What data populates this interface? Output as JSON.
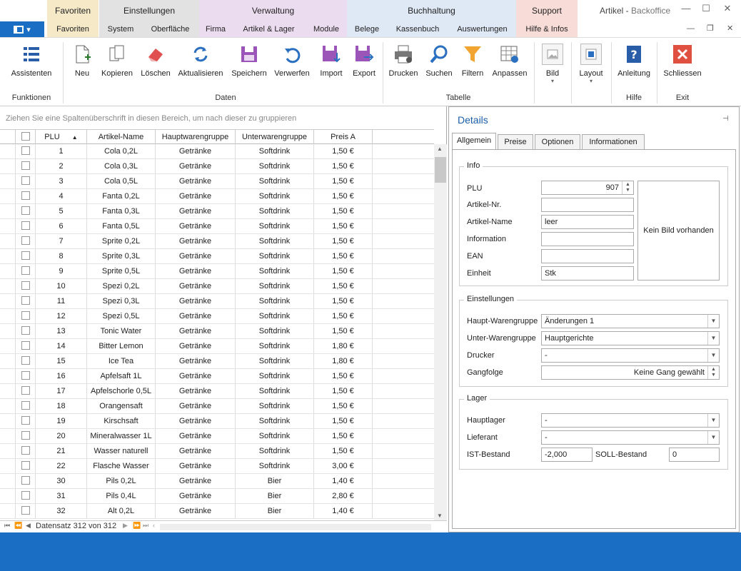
{
  "window": {
    "title_app": "Artikel",
    "title_sep": " - ",
    "title_module": "Backoffice",
    "minimize": "—",
    "maximize": "☐",
    "close": "✕"
  },
  "appmenu": {
    "icon": "panel-icon",
    "chevron": "▾"
  },
  "ribbon_groups": [
    {
      "name": "Favoriten",
      "color": "#f5e9c8",
      "tabs": [
        "Favoriten"
      ]
    },
    {
      "name": "Einstellungen",
      "color": "#e2e2e2",
      "tabs": [
        "System",
        "Oberfläche"
      ]
    },
    {
      "name": "Verwaltung",
      "color": "#ecdcef",
      "tabs": [
        "Firma",
        "Artikel & Lager",
        "Module"
      ]
    },
    {
      "name": "Buchhaltung",
      "color": "#dfe8f5",
      "tabs": [
        "Belege",
        "Kassenbuch",
        "Auswertungen"
      ]
    },
    {
      "name": "Support",
      "color": "#f8dcd8",
      "tabs": [
        "Hilfe & Infos"
      ]
    }
  ],
  "ribbon_buttons": {
    "assistenten": "Assistenten",
    "neu": "Neu",
    "kopieren": "Kopieren",
    "loeschen": "Löschen",
    "aktualisieren": "Aktualisieren",
    "speichern": "Speichern",
    "verwerfen": "Verwerfen",
    "import": "Import",
    "export": "Export",
    "drucken": "Drucken",
    "suchen": "Suchen",
    "filtern": "Filtern",
    "anpassen": "Anpassen",
    "bild": "Bild",
    "layout": "Layout",
    "anleitung": "Anleitung",
    "schliessen": "Schliessen"
  },
  "ribbon_group_labels": {
    "funktionen": "Funktionen",
    "daten": "Daten",
    "tabelle": "Tabelle",
    "hilfe": "Hilfe",
    "exit": "Exit"
  },
  "grid": {
    "group_hint": "Ziehen Sie eine Spaltenüberschrift in diesen Bereich, um nach dieser zu gruppieren",
    "columns": [
      "PLU",
      "Artikel-Name",
      "Hauptwarengruppe",
      "Unterwarengruppe",
      "Preis A"
    ],
    "rows": [
      [
        "1",
        "Cola 0,2L",
        "Getränke",
        "Softdrink",
        "1,50 €"
      ],
      [
        "2",
        "Cola 0,3L",
        "Getränke",
        "Softdrink",
        "1,50 €"
      ],
      [
        "3",
        "Cola 0,5L",
        "Getränke",
        "Softdrink",
        "1,50 €"
      ],
      [
        "4",
        "Fanta 0,2L",
        "Getränke",
        "Softdrink",
        "1,50 €"
      ],
      [
        "5",
        "Fanta 0,3L",
        "Getränke",
        "Softdrink",
        "1,50 €"
      ],
      [
        "6",
        "Fanta 0,5L",
        "Getränke",
        "Softdrink",
        "1,50 €"
      ],
      [
        "7",
        "Sprite 0,2L",
        "Getränke",
        "Softdrink",
        "1,50 €"
      ],
      [
        "8",
        "Sprite 0,3L",
        "Getränke",
        "Softdrink",
        "1,50 €"
      ],
      [
        "9",
        "Sprite 0,5L",
        "Getränke",
        "Softdrink",
        "1,50 €"
      ],
      [
        "10",
        "Spezi 0,2L",
        "Getränke",
        "Softdrink",
        "1,50 €"
      ],
      [
        "11",
        "Spezi 0,3L",
        "Getränke",
        "Softdrink",
        "1,50 €"
      ],
      [
        "12",
        "Spezi 0,5L",
        "Getränke",
        "Softdrink",
        "1,50 €"
      ],
      [
        "13",
        "Tonic Water",
        "Getränke",
        "Softdrink",
        "1,50 €"
      ],
      [
        "14",
        "Bitter Lemon",
        "Getränke",
        "Softdrink",
        "1,80 €"
      ],
      [
        "15",
        "Ice Tea",
        "Getränke",
        "Softdrink",
        "1,80 €"
      ],
      [
        "16",
        "Apfelsaft 1L",
        "Getränke",
        "Softdrink",
        "1,50 €"
      ],
      [
        "17",
        "Apfelschorle 0,5L",
        "Getränke",
        "Softdrink",
        "1,50 €"
      ],
      [
        "18",
        "Orangensaft",
        "Getränke",
        "Softdrink",
        "1,50 €"
      ],
      [
        "19",
        "Kirschsaft",
        "Getränke",
        "Softdrink",
        "1,50 €"
      ],
      [
        "20",
        "Mineralwasser 1L",
        "Getränke",
        "Softdrink",
        "1,50 €"
      ],
      [
        "21",
        "Wasser naturell",
        "Getränke",
        "Softdrink",
        "1,50 €"
      ],
      [
        "22",
        "Flasche Wasser",
        "Getränke",
        "Softdrink",
        "3,00 €"
      ],
      [
        "30",
        "Pils 0,2L",
        "Getränke",
        "Bier",
        "1,40 €"
      ],
      [
        "31",
        "Pils 0,4L",
        "Getränke",
        "Bier",
        "2,80 €"
      ],
      [
        "32",
        "Alt 0,2L",
        "Getränke",
        "Bier",
        "1,40 €"
      ]
    ],
    "record_text": "Datensatz 312 von 312"
  },
  "details": {
    "title": "Details",
    "pin": "⊣",
    "tabs": [
      "Allgemein",
      "Preise",
      "Optionen",
      "Informationen"
    ],
    "info": {
      "legend": "Info",
      "plu_label": "PLU",
      "plu_value": "907",
      "artnr_label": "Artikel-Nr.",
      "artnr_value": "",
      "name_label": "Artikel-Name",
      "name_value": "leer",
      "information_label": "Information",
      "information_value": "",
      "ean_label": "EAN",
      "ean_value": "",
      "einheit_label": "Einheit",
      "einheit_value": "Stk",
      "image_text": "Kein Bild vorhanden"
    },
    "settings": {
      "legend": "Einstellungen",
      "hwg_label": "Haupt-Warengruppe",
      "hwg_value": "Änderungen 1",
      "uwg_label": "Unter-Warengruppe",
      "uwg_value": "Hauptgerichte",
      "drucker_label": "Drucker",
      "drucker_value": "-",
      "gang_label": "Gangfolge",
      "gang_value": "Keine Gang gewählt"
    },
    "lager": {
      "legend": "Lager",
      "hl_label": "Hauptlager",
      "hl_value": "-",
      "lief_label": "Lieferant",
      "lief_value": "-",
      "ist_label": "IST-Bestand",
      "ist_value": "-2,000",
      "soll_label": "SOLL-Bestand",
      "soll_value": "0"
    }
  }
}
